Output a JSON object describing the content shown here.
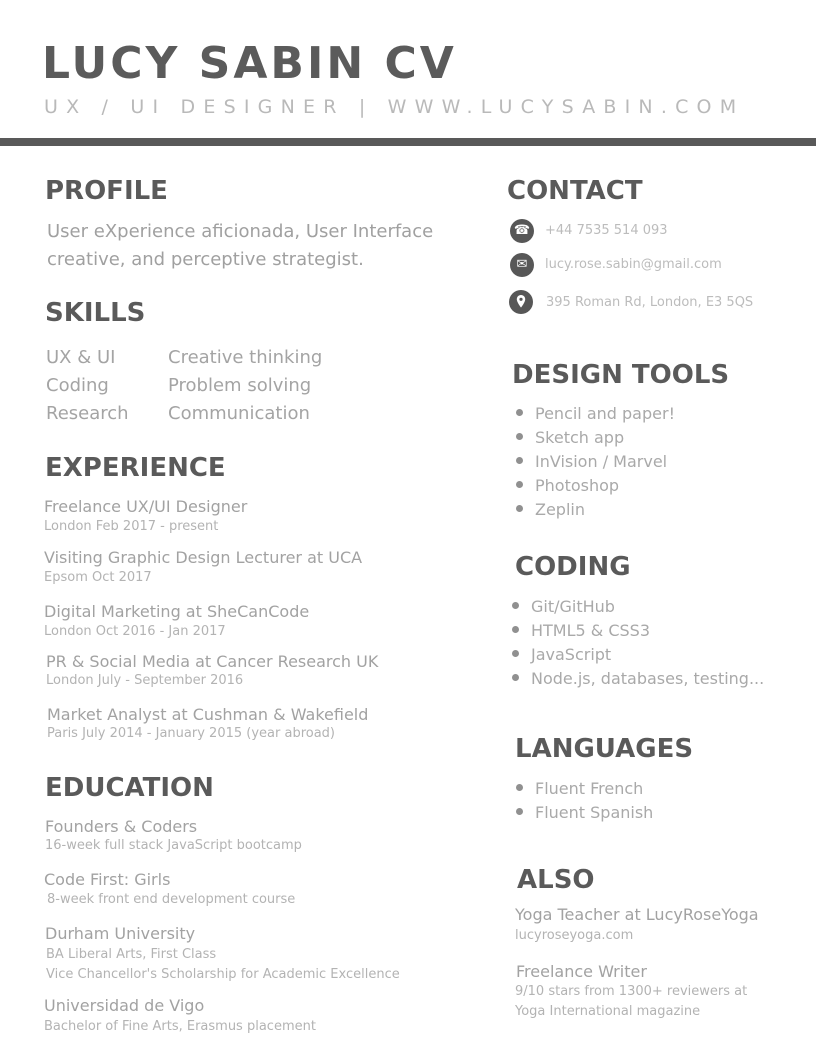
{
  "header": {
    "name": "LUCY SABIN CV",
    "subtitle": "UX / UI DESIGNER | WWW.LUCYSABIN.COM"
  },
  "profile": {
    "heading": "PROFILE",
    "lines": [
      "User eXperience aficionada, User Interface",
      "creative, and perceptive strategist."
    ]
  },
  "skills": {
    "heading": "SKILLS",
    "col1": [
      "UX & UI",
      "Coding",
      "Research"
    ],
    "col2": [
      "Creative thinking",
      "Problem solving",
      "Communication"
    ]
  },
  "experience": {
    "heading": "EXPERIENCE",
    "items": [
      {
        "title": "Freelance UX/UI Designer",
        "detail": "London Feb 2017 - present"
      },
      {
        "title": "Visiting Graphic Design Lecturer at UCA",
        "detail": "Epsom Oct 2017"
      },
      {
        "title": "Digital Marketing at SheCanCode",
        "detail": "London Oct 2016 - Jan 2017"
      },
      {
        "title": "PR & Social Media at Cancer Research UK",
        "detail": "London July - September 2016"
      },
      {
        "title": "Market Analyst at Cushman & Wakefield",
        "detail": "Paris July 2014 - January 2015 (year abroad)"
      }
    ]
  },
  "education": {
    "heading": "EDUCATION",
    "items": [
      {
        "title": "Founders & Coders",
        "details": [
          "16-week full stack JavaScript bootcamp"
        ]
      },
      {
        "title": "Code First: Girls",
        "details": [
          "8-week front end development course"
        ]
      },
      {
        "title": "Durham University",
        "details": [
          "BA Liberal Arts, First Class",
          "Vice Chancellor's Scholarship for Academic Excellence"
        ]
      },
      {
        "title": "Universidad de Vigo",
        "details": [
          "Bachelor of Fine Arts, Erasmus placement"
        ]
      }
    ]
  },
  "contact": {
    "heading": "CONTACT",
    "phone": "+44 7535 514 093",
    "email": "lucy.rose.sabin@gmail.com",
    "address": "395 Roman Rd, London, E3 5QS",
    "icons": [
      "phone-icon",
      "envelope-icon",
      "location-pin-icon"
    ]
  },
  "design_tools": {
    "heading": "DESIGN TOOLS",
    "items": [
      "Pencil and paper!",
      "Sketch app",
      "InVision / Marvel",
      "Photoshop",
      "Zeplin"
    ]
  },
  "coding": {
    "heading": "CODING",
    "items": [
      "Git/GitHub",
      "HTML5 & CSS3",
      "JavaScript",
      "Node.js, databases, testing..."
    ]
  },
  "languages": {
    "heading": "LANGUAGES",
    "items": [
      "Fluent French",
      "Fluent Spanish"
    ]
  },
  "also": {
    "heading": "ALSO",
    "items": [
      {
        "title": "Yoga Teacher at LucyRoseYoga",
        "details": [
          "lucyroseyoga.com"
        ]
      },
      {
        "title": "Freelance Writer",
        "details": [
          "9/10 stars from 1300+ reviewers at",
          "Yoga International magazine"
        ]
      }
    ]
  },
  "colors": {
    "accent": "#595959",
    "heading": "#5a5a5a",
    "body_text": "#a2a2a2"
  }
}
